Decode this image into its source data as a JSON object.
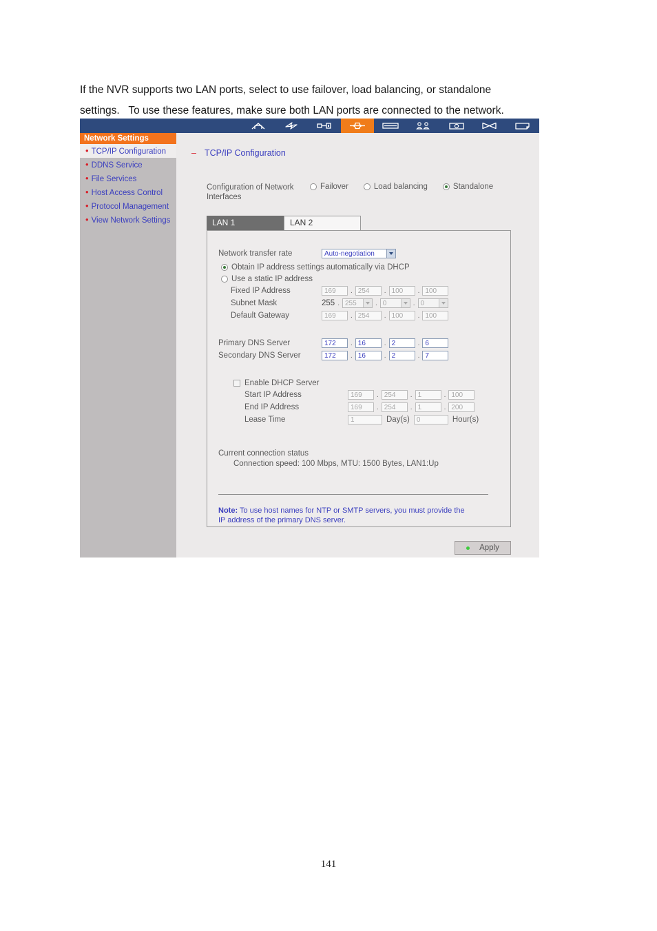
{
  "document": {
    "intro_line_1": "If the NVR supports two LAN ports, select to use failover, load balancing, or standalone",
    "intro_line_2": "settings.   To use these features, make sure both LAN ports are connected to the network.",
    "page_number": "141"
  },
  "colors": {
    "toolbar_bg": "#2e4a7d",
    "accent_orange": "#f3731d",
    "link_blue": "#3b3fbf",
    "bullet_red": "#d8202b",
    "status_green": "#3ecb3e"
  },
  "toolbar": {
    "items": [
      {
        "icon": "home-icon",
        "active": false
      },
      {
        "icon": "power-lightning-icon",
        "active": false
      },
      {
        "icon": "key-icon",
        "active": false
      },
      {
        "icon": "network-icon",
        "active": true
      },
      {
        "icon": "disk-icon",
        "active": false
      },
      {
        "icon": "users-icon",
        "active": false
      },
      {
        "icon": "backup-camera-icon",
        "active": false
      },
      {
        "icon": "mail-icon",
        "active": false
      },
      {
        "icon": "logs-icon",
        "active": false
      }
    ]
  },
  "sidebar": {
    "title": "Network Settings",
    "items": [
      {
        "label": "TCP/IP Configuration",
        "selected": true
      },
      {
        "label": "DDNS Service",
        "selected": false
      },
      {
        "label": "File Services",
        "selected": false
      },
      {
        "label": "Host Access Control",
        "selected": false
      },
      {
        "label": "Protocol Management",
        "selected": false
      },
      {
        "label": "View Network Settings",
        "selected": false
      }
    ]
  },
  "main": {
    "section_title": "TCP/IP Configuration",
    "interfaces": {
      "label_line_1": "Configuration of Network",
      "label_line_2": "Interfaces",
      "options": [
        {
          "label": "Failover",
          "selected": false
        },
        {
          "label": "Load balancing",
          "selected": false
        },
        {
          "label": "Standalone",
          "selected": true
        }
      ]
    },
    "tabs": [
      {
        "label": "LAN 1",
        "active": true
      },
      {
        "label": "LAN 2",
        "active": false
      }
    ],
    "transfer_rate": {
      "label": "Network transfer rate",
      "value": "Auto-negotiation"
    },
    "ip_mode": {
      "dhcp_label": "Obtain IP address settings automatically via DHCP",
      "dhcp_selected": true,
      "static_label": "Use a static IP address",
      "static_selected": false
    },
    "static": {
      "fixed_ip": {
        "label": "Fixed IP Address",
        "octets": [
          "169",
          "254",
          "100",
          "100"
        ]
      },
      "subnet_mask": {
        "label": "Subnet Mask",
        "first": "255",
        "octets": [
          "255",
          "0",
          "0"
        ]
      },
      "gateway": {
        "label": "Default Gateway",
        "octets": [
          "169",
          "254",
          "100",
          "100"
        ]
      }
    },
    "dns": {
      "primary": {
        "label": "Primary DNS Server",
        "octets": [
          "172",
          "16",
          "2",
          "6"
        ]
      },
      "secondary": {
        "label": "Secondary DNS Server",
        "octets": [
          "172",
          "16",
          "2",
          "7"
        ]
      }
    },
    "dhcp_server": {
      "enable_label": "Enable DHCP Server",
      "enabled": false,
      "start_ip": {
        "label": "Start IP Address",
        "octets": [
          "169",
          "254",
          "1",
          "100"
        ]
      },
      "end_ip": {
        "label": "End IP Address",
        "octets": [
          "169",
          "254",
          "1",
          "200"
        ]
      },
      "lease_time": {
        "label": "Lease Time",
        "days": "1",
        "days_unit": "Day(s)",
        "hours": "0",
        "hours_unit": "Hour(s)"
      }
    },
    "connection_status": {
      "label": "Current connection status",
      "detail": "Connection speed: 100 Mbps, MTU: 1500 Bytes, LAN1:Up"
    },
    "note": {
      "prefix": "Note:",
      "line_1": " To use host names for NTP or SMTP servers, you must provide the",
      "line_2": "IP address of the primary DNS server."
    },
    "apply_label": "Apply"
  }
}
